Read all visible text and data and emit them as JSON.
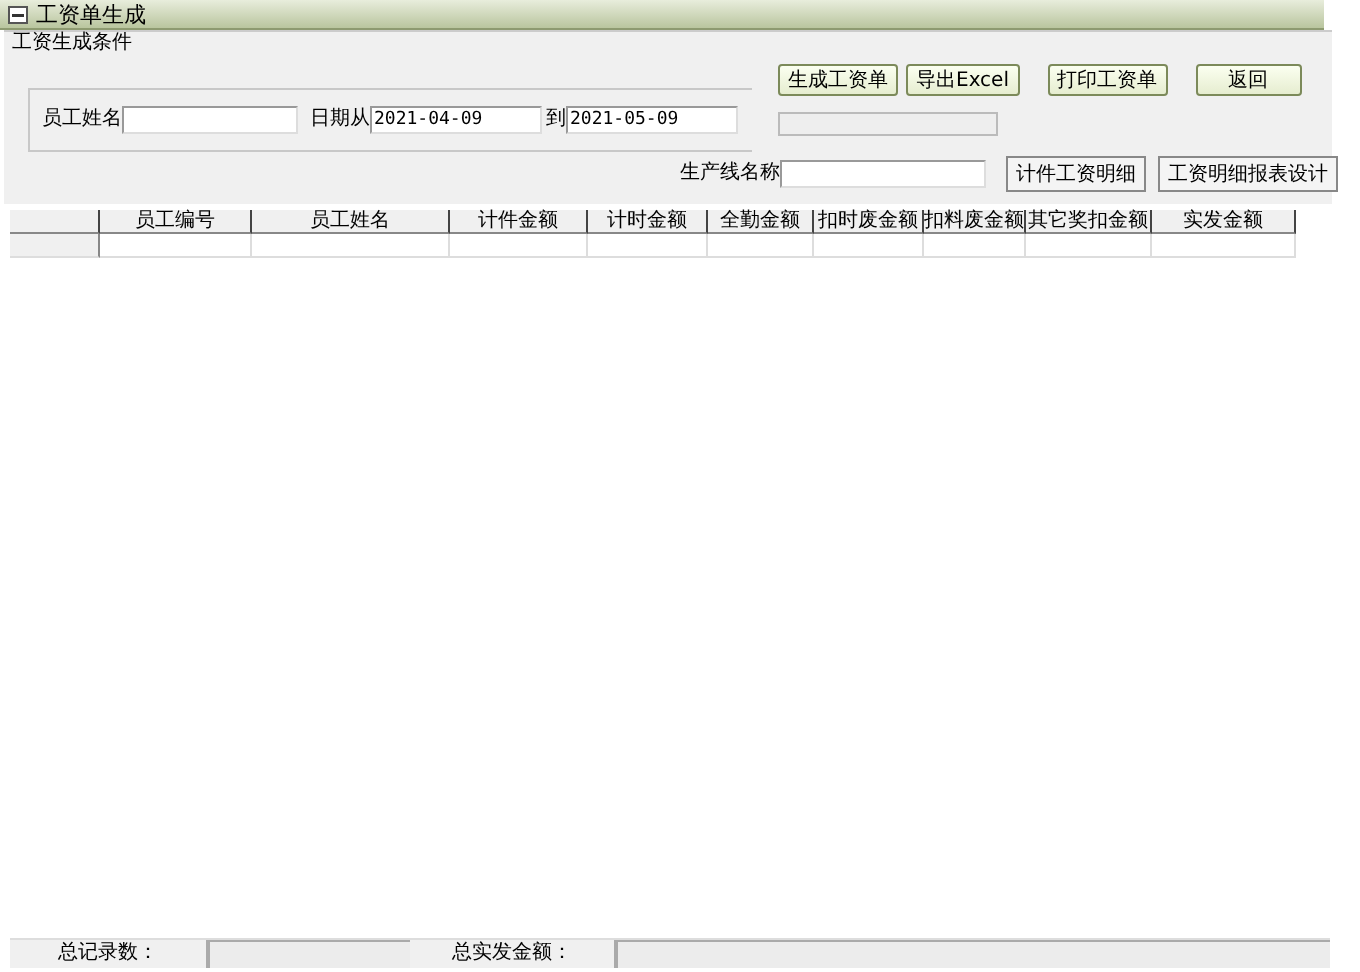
{
  "window": {
    "title": "工资单生成"
  },
  "group": {
    "title": "工资生成条件"
  },
  "filters": {
    "employee_name_label": "员工姓名",
    "date_from_label": "日期从",
    "date_from": "2021-04-09",
    "date_to_label": "到",
    "date_to": "2021-05-09",
    "line_label": "生产线名称"
  },
  "buttons": [
    "生成工资单",
    "导出Excel",
    "打印工资单",
    "返回"
  ],
  "detail_buttons": [
    "计件工资明细",
    "工资明细报表设计"
  ],
  "table": {
    "columns": [
      "员工编号",
      "员工姓名",
      "计件金额",
      "计时金额",
      "全勤金额",
      "扣时废金额",
      "扣料废金额",
      "其它奖扣金额",
      "实发金额"
    ]
  },
  "status_bar": [
    {
      "label": "总记录数："
    },
    {
      "label": "总实发金额："
    }
  ]
}
